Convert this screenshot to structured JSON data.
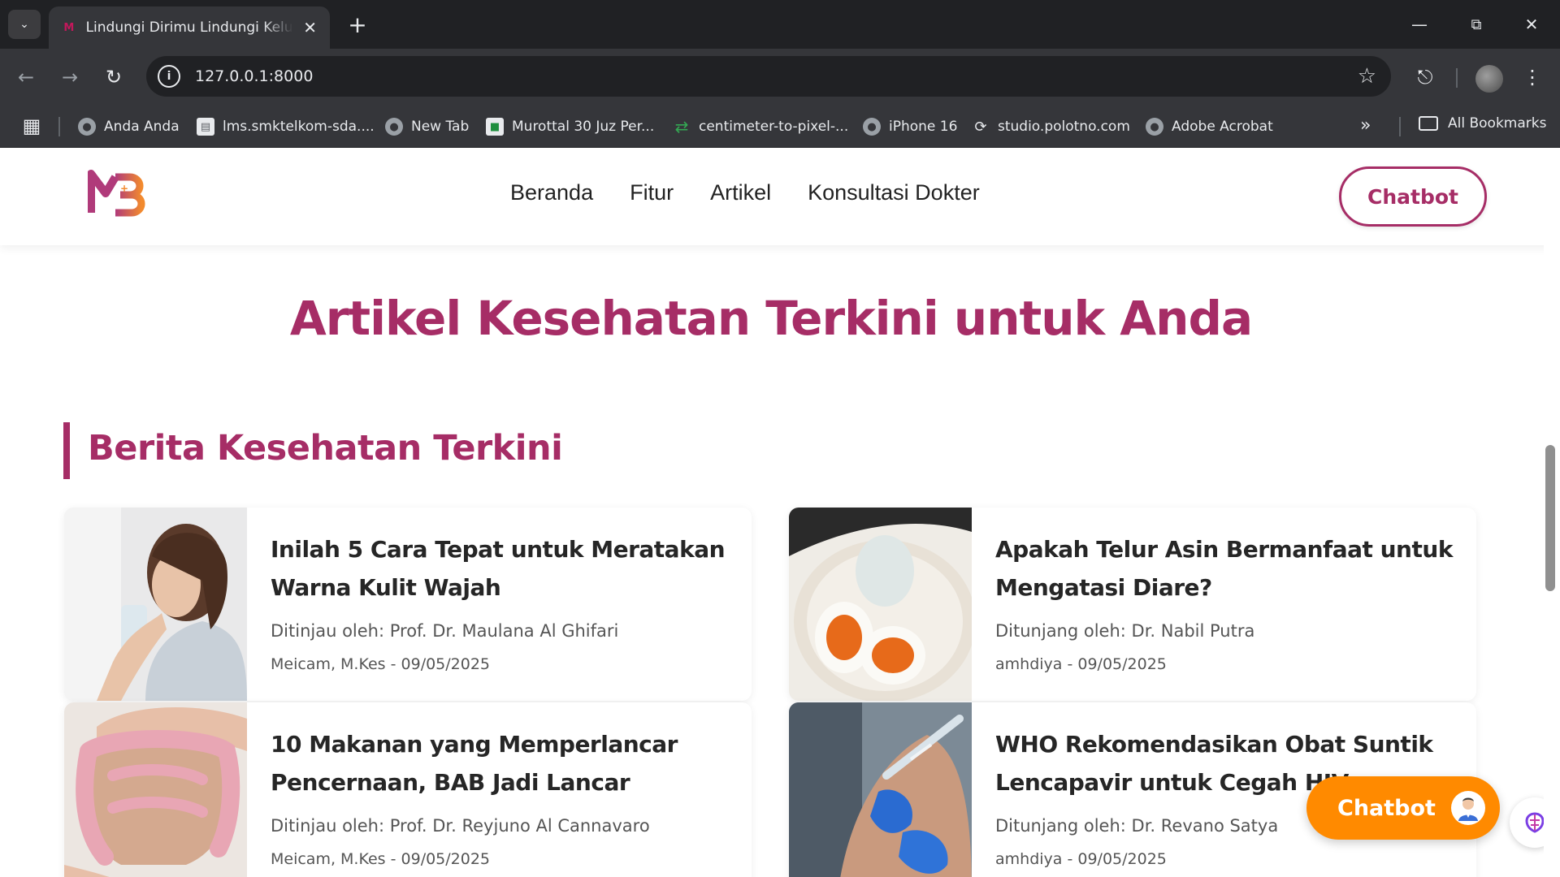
{
  "browser": {
    "tab_title": "Lindungi Dirimu Lindungi Keluarga",
    "url": "127.0.0.1:8000",
    "icons": [
      "tab-search-icon",
      "favicon-mb-icon",
      "close-icon",
      "plus-icon",
      "minimize-icon",
      "restore-icon",
      "window-close-icon",
      "back-icon",
      "forward-icon",
      "reload-icon",
      "info-icon",
      "star-icon",
      "extensions-icon",
      "profile-avatar",
      "menu-icon"
    ],
    "bookmarks": [
      {
        "label": "Anda Anda",
        "icon": "globe"
      },
      {
        "label": "lms.smktelkom-sda....",
        "icon": "doc"
      },
      {
        "label": "New Tab",
        "icon": "globe"
      },
      {
        "label": "Murottal 30 Juz Per...",
        "icon": "green"
      },
      {
        "label": "centimeter-to-pixel-...",
        "icon": "arrow"
      },
      {
        "label": "iPhone 16",
        "icon": "globe"
      },
      {
        "label": "studio.polotno.com",
        "icon": "poly"
      },
      {
        "label": "Adobe Acrobat",
        "icon": "globe"
      }
    ],
    "all_bookmarks": "All Bookmarks"
  },
  "site": {
    "logo_text": "MB",
    "nav": [
      "Beranda",
      "Fitur",
      "Artikel",
      "Konsultasi Dokter"
    ],
    "chatbot_label": "Chatbot",
    "hero_title": "Artikel Kesehatan Terkini untuk Anda",
    "section_title": "Berita Kesehatan Terkini",
    "articles": [
      {
        "title": "Inilah 5 Cara Tepat untuk Meratakan Warna Kulit Wajah",
        "reviewer": "Ditinjau oleh: Prof. Dr. Maulana Al Ghifari",
        "author": "Meicam, M.Kes",
        "date": "09/05/2025",
        "image": "woman-drinking-water"
      },
      {
        "title": "Apakah Telur Asin Bermanfaat untuk Mengatasi Diare?",
        "reviewer": "Ditunjang oleh: Dr. Nabil Putra",
        "author": "amhdiya",
        "date": "09/05/2025",
        "image": "salted-eggs"
      },
      {
        "title": "10 Makanan yang Memperlancar Pencernaan, BAB Jadi Lancar",
        "reviewer": "Ditinjau oleh: Prof. Dr. Reyjuno Al Cannavaro",
        "author": "Meicam, M.Kes",
        "date": "09/05/2025",
        "image": "intestine-illustration"
      },
      {
        "title": "WHO Rekomendasikan Obat Suntik Lencapavir untuk Cegah HIV",
        "reviewer": "Ditunjang oleh: Dr. Revano Satya",
        "author": "amhdiya",
        "date": "09/05/2025",
        "image": "injection-arm"
      }
    ],
    "meta_separator": " - ",
    "float_chatbot_label": "Chatbot"
  },
  "colors": {
    "brand": "#a62d66",
    "accent": "#ff8a00",
    "chrome_dark": "#202124",
    "chrome": "#35363a"
  }
}
